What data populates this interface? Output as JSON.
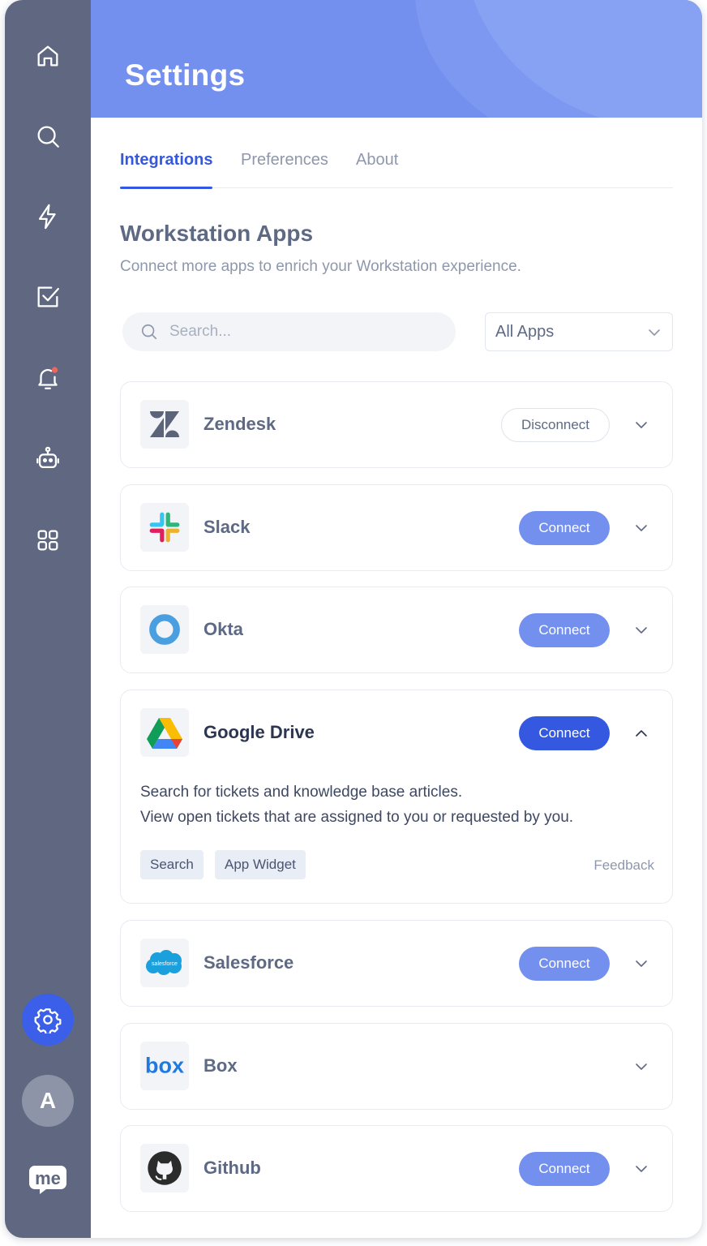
{
  "header": {
    "title": "Settings"
  },
  "tabs": [
    {
      "label": "Integrations",
      "active": true
    },
    {
      "label": "Preferences",
      "active": false
    },
    {
      "label": "About",
      "active": false
    }
  ],
  "section": {
    "title": "Workstation Apps",
    "subtitle": "Connect more apps to enrich your Workstation experience."
  },
  "search": {
    "placeholder": "Search...",
    "value": ""
  },
  "filter": {
    "selected": "All Apps"
  },
  "sidebar": {
    "items": [
      {
        "icon": "home-icon"
      },
      {
        "icon": "search-icon"
      },
      {
        "icon": "lightning-icon"
      },
      {
        "icon": "checkbox-icon"
      },
      {
        "icon": "bell-icon",
        "notification_dot": true
      },
      {
        "icon": "robot-icon"
      },
      {
        "icon": "grid-icon"
      },
      {
        "icon": "gear-icon",
        "active": true
      }
    ],
    "avatar_initial": "A",
    "logo_text": "me"
  },
  "apps": [
    {
      "name": "Zendesk",
      "action": "Disconnect",
      "expanded": false,
      "icon": "zendesk-logo"
    },
    {
      "name": "Slack",
      "action": "Connect",
      "expanded": false,
      "icon": "slack-logo"
    },
    {
      "name": "Okta",
      "action": "Connect",
      "expanded": false,
      "icon": "okta-logo"
    },
    {
      "name": "Google Drive",
      "action": "Connect",
      "expanded": true,
      "icon": "google-drive-logo",
      "description": [
        "Search for tickets and knowledge base articles.",
        "View open tickets that are assigned to you or requested by you."
      ],
      "tags": [
        "Search",
        "App Widget"
      ],
      "feedback_label": "Feedback"
    },
    {
      "name": "Salesforce",
      "action": "Connect",
      "expanded": false,
      "icon": "salesforce-logo",
      "logo_text": "salesforce"
    },
    {
      "name": "Box",
      "action": "",
      "expanded": false,
      "icon": "box-logo",
      "logo_text": "box"
    },
    {
      "name": "Github",
      "action": "Connect",
      "expanded": false,
      "icon": "github-logo"
    }
  ],
  "colors": {
    "sidebar": "#5f6880",
    "header": "#7490ef",
    "accent": "#3459e0",
    "connect_muted": "#7490ef",
    "notification": "#e8675e"
  }
}
